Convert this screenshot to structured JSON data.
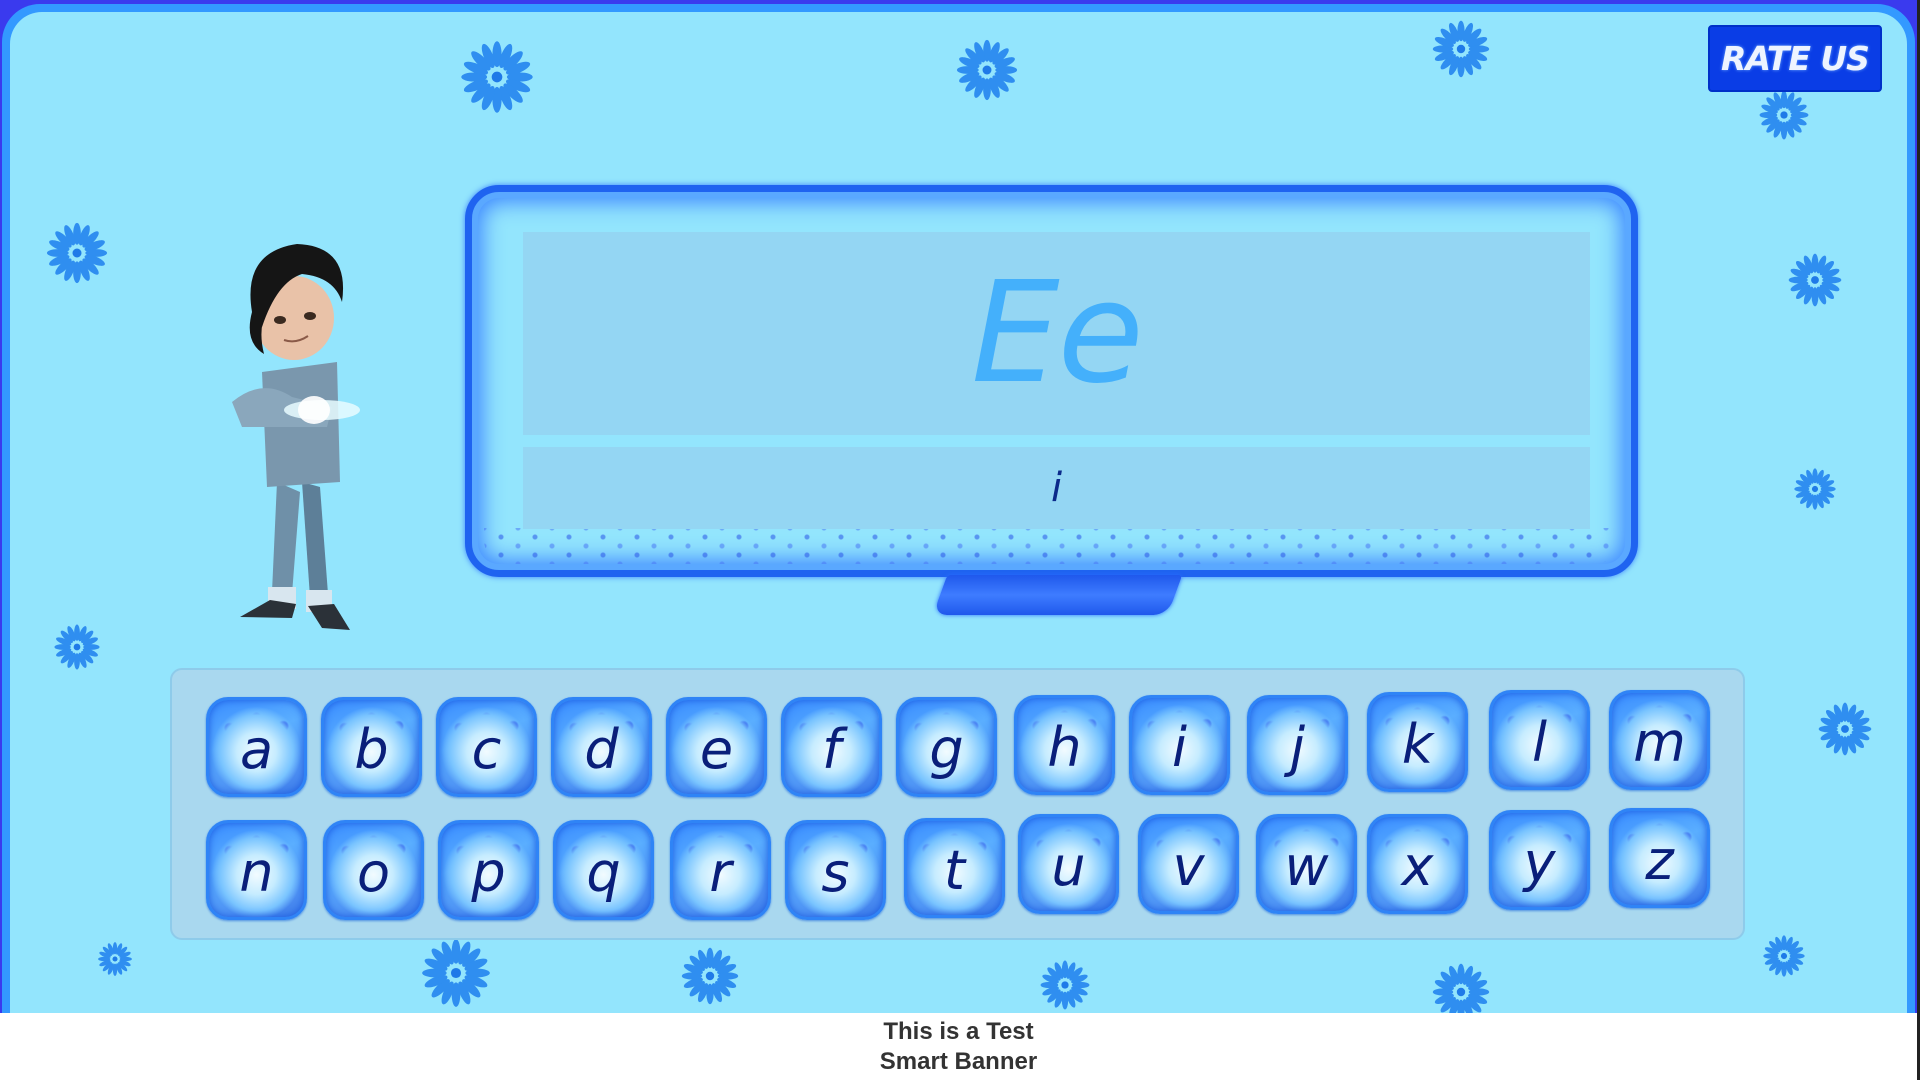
{
  "header": {
    "rate_button_label": "RATE US"
  },
  "display": {
    "current_letter": "Ee",
    "hint_letter": "i"
  },
  "keyboard": {
    "row1": [
      "a",
      "b",
      "c",
      "d",
      "e",
      "f",
      "g",
      "h",
      "i",
      "j",
      "k",
      "l",
      "m"
    ],
    "row2": [
      "n",
      "o",
      "p",
      "q",
      "r",
      "s",
      "t",
      "u",
      "v",
      "w",
      "x",
      "y",
      "z"
    ]
  },
  "banner": {
    "line1": "This is a Test",
    "line2": "Smart Banner"
  },
  "colors": {
    "background": "#93e5fd",
    "frame_border": "#3399ff",
    "rate_button": "#0a3de6",
    "big_letter": "#44b0fb",
    "key_letter": "#0a1f7a"
  },
  "decorations": {
    "snowflake_count": 15,
    "character": "cartoon-boy"
  }
}
